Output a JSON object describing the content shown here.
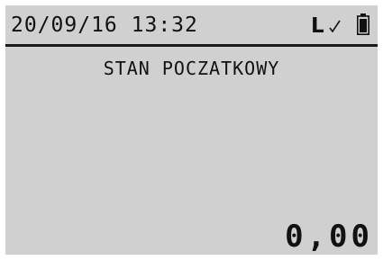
{
  "status_bar": {
    "datetime": "20/09/16 13:32",
    "mode_letter": "L",
    "check_icon": "check-icon",
    "battery_icon": "battery-full-icon"
  },
  "main": {
    "title": "STAN POCZATKOWY",
    "amount": "0,00"
  },
  "colors": {
    "screen_background": "#cfd0cf",
    "text": "#111111"
  }
}
